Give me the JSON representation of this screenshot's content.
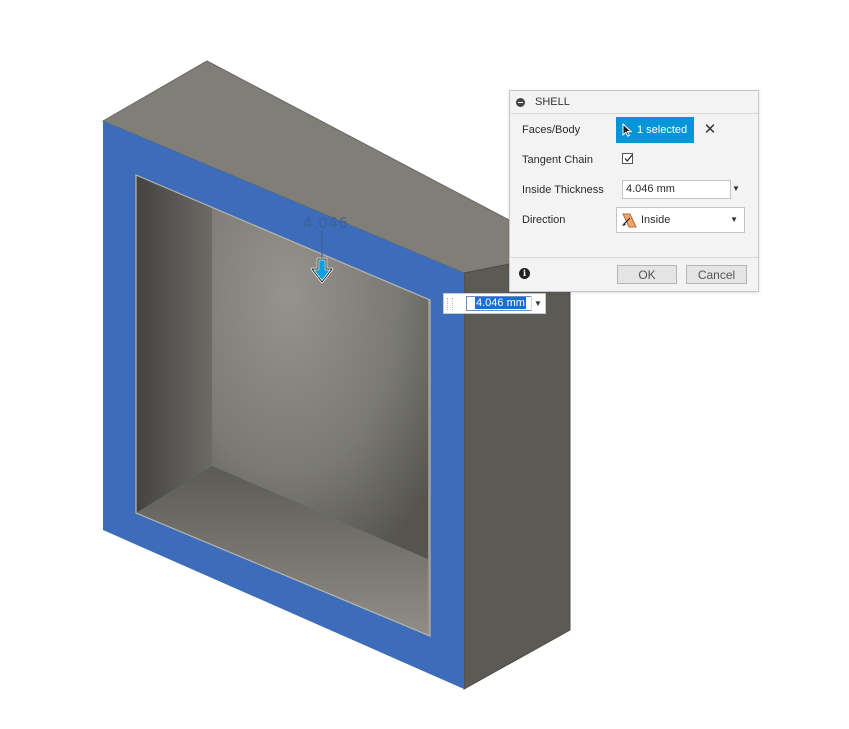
{
  "canvas": {
    "dimension_readout": "4.046",
    "floating_input_value": "4.046 mm"
  },
  "dialog": {
    "title": "SHELL",
    "faces_body_label": "Faces/Body",
    "selection_label": "1 selected",
    "tangent_chain_label": "Tangent Chain",
    "tangent_chain_checked": true,
    "inside_thickness_label": "Inside Thickness",
    "inside_thickness_value": "4.046 mm",
    "direction_label": "Direction",
    "direction_value": "Inside",
    "ok_label": "OK",
    "cancel_label": "Cancel"
  },
  "colors": {
    "selected_face": "#3d6cba",
    "outer_body": "#7d7a73",
    "inner_cavity": "#6f6d67",
    "accent": "#0696d7"
  },
  "icons": {
    "drag_handle": "down-arrow-icon",
    "selection": "cursor-arrow-icon",
    "clear": "close-icon",
    "direction": "inside-direction-icon",
    "info": "info-icon",
    "collapse": "collapse-icon"
  }
}
